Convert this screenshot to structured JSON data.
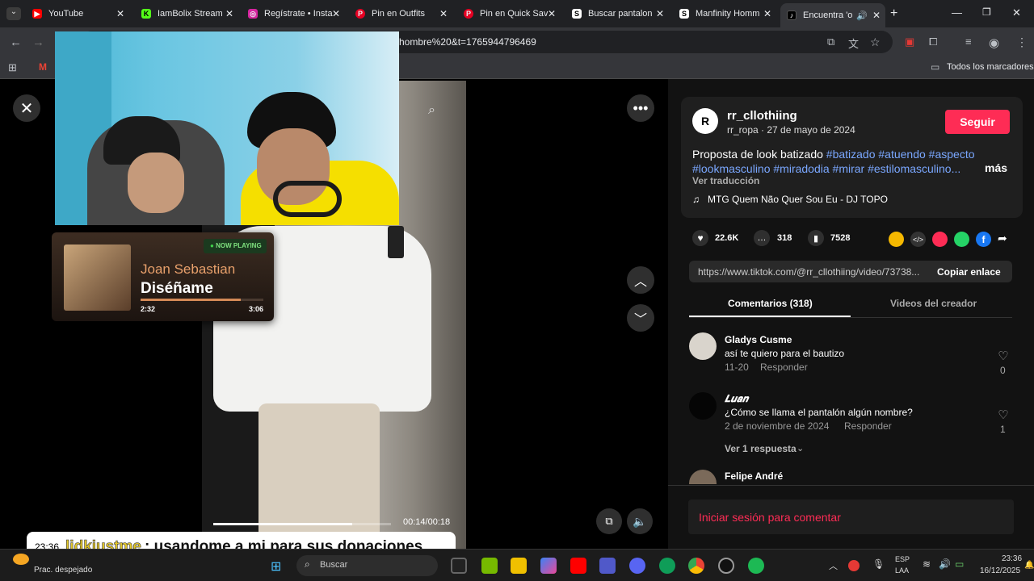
{
  "tabs": [
    {
      "label": "YouTube",
      "icon": "youtube-icon",
      "color": "#ff0000"
    },
    {
      "label": "IamBolix Stream",
      "icon": "kick-icon",
      "color": "#53fc18"
    },
    {
      "label": "Regístrate • Insta",
      "icon": "instagram-icon",
      "color": "#d6249f"
    },
    {
      "label": "Pin en Outfits",
      "icon": "pinterest-icon",
      "color": "#e60023"
    },
    {
      "label": "Pin en Quick Sav",
      "icon": "pinterest-icon",
      "color": "#e60023"
    },
    {
      "label": "Buscar pantalon",
      "icon": "s-icon",
      "color": "#ffffff"
    },
    {
      "label": "Manfinity Homm",
      "icon": "s-icon",
      "color": "#ffffff"
    },
    {
      "label": "Encuentra 'o",
      "icon": "tiktok-icon",
      "color": "#ffffff"
    }
  ],
  "address": {
    "url": "hombre%20&t=1765944796469"
  },
  "bookmarks": {
    "all_label": "Todos los marcadores"
  },
  "post": {
    "username": "rr_cllothiing",
    "subtitle": "rr_ropa · 27 de mayo de 2024",
    "follow_label": "Seguir",
    "caption_text": "Proposta de look batizado ",
    "hashtags_line1": "#batizado #atuendo #aspecto",
    "hashtags_line2": "#lookmasculino #miradodia #mirar #estilomasculino...",
    "more_label": "más",
    "translate_label": "Ver traducción",
    "music": "MTG Quem Não Quer Sou Eu - DJ TOPO",
    "likes": "22.6K",
    "comments_count": "318",
    "saves": "7528",
    "link": "https://www.tiktok.com/@rr_cllothiing/video/73738...",
    "copy_label": "Copiar enlace",
    "tab_comments": "Comentarios (318)",
    "tab_creator": "Videos del creador"
  },
  "comments": [
    {
      "user": "Gladys Cusme",
      "text": "así te quiero para el bautizo",
      "date": "11-20",
      "reply": "Responder",
      "likes": "0"
    },
    {
      "user": "𝑳𝒖𝒂𝒏",
      "text": "¿Cómo se llama el pantalón algún nombre?",
      "date": "2 de noviembre de 2024",
      "reply": "Responder",
      "likes": "1",
      "view_replies": "Ver 1 respuesta"
    },
    {
      "user": "Felipe André"
    }
  ],
  "login_prompt": "Iniciar sesión para comentar",
  "video": {
    "time": "00:14/00:18",
    "progress": 0.78
  },
  "now_playing": {
    "badge": "NOW PLAYING",
    "artist": "Joan Sebastian",
    "song": "Diséñame",
    "elapsed": "2:32",
    "total": "3:06",
    "progress": 0.82
  },
  "chat": {
    "time": "23:36",
    "user": "lidkjustme",
    "message": ": usandome a mi para sus donaciones"
  },
  "taskbar": {
    "weather": "Prac. despejado",
    "search": "Buscar",
    "lang1": "ESP",
    "lang2": "LAA",
    "clock": "23:36",
    "date": "16/12/2025"
  }
}
